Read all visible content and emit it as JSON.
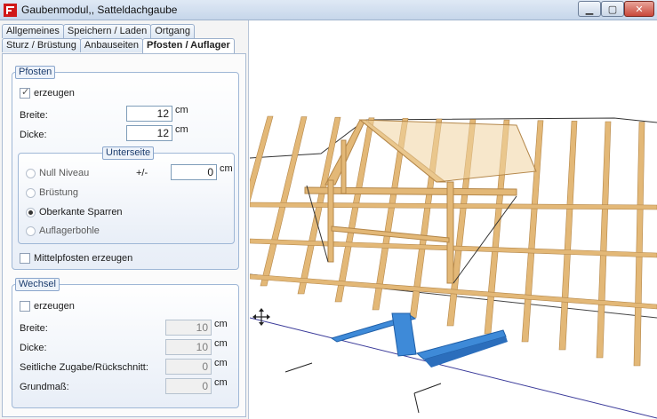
{
  "window": {
    "title": "Gaubenmodul,, Satteldachgaube"
  },
  "tabs": {
    "row1": [
      "Allgemeines",
      "Speichern / Laden",
      "Ortgang"
    ],
    "row2": [
      "Sturz / Brüstung",
      "Anbauseiten",
      "Pfosten / Auflager"
    ]
  },
  "pfosten": {
    "title": "Pfosten",
    "erzeugen": "erzeugen",
    "breite_label": "Breite:",
    "breite_value": "12",
    "dicke_label": "Dicke:",
    "dicke_value": "12",
    "unit": "cm",
    "unterseite": {
      "title": "Unterseite",
      "options": [
        "Null Niveau",
        "Brüstung",
        "Oberkante Sparren",
        "Auflagerbohle"
      ],
      "selected": "Oberkante Sparren",
      "pm_label": "+/-",
      "pm_value": "0"
    },
    "mittelpfosten": "Mittelpfosten erzeugen"
  },
  "wechsel": {
    "title": "Wechsel",
    "erzeugen": "erzeugen",
    "breite_label": "Breite:",
    "breite_value": "10",
    "dicke_label": "Dicke:",
    "dicke_value": "10",
    "zugabe_label": "Seitliche Zugabe/Rückschnitt:",
    "zugabe_value": "0",
    "grundmass_label": "Grundmaß:",
    "grundmass_value": "0",
    "unit": "cm"
  },
  "colors": {
    "wood": "#e3b877",
    "wood_dark": "#b4874a",
    "wood_light": "#f0d3a0",
    "selection": "#3e8ad8",
    "group_border": "#9fb7d6"
  }
}
